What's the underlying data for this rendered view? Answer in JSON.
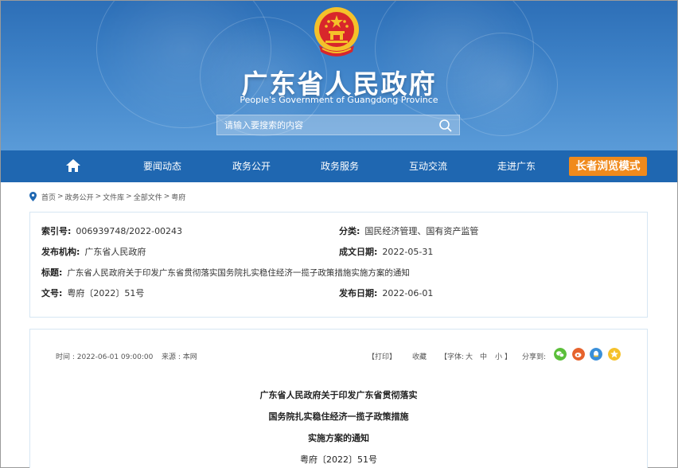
{
  "banner": {
    "title": "广东省人民政府",
    "subtitle": "People's Government of Guangdong Province",
    "search_placeholder": "请输入要搜索的内容"
  },
  "nav": {
    "items": [
      "要闻动态",
      "政务公开",
      "政务服务",
      "互动交流",
      "走进广东"
    ],
    "elder_mode": "长者浏览模式"
  },
  "breadcrumb": [
    "首页",
    "政务公开",
    "文件库",
    "全部文件",
    "粤府"
  ],
  "meta": {
    "index_no_label": "索引号:",
    "index_no": "006939748/2022-00243",
    "category_label": "分类:",
    "category": "国民经济管理、国有资产监管",
    "publisher_label": "发布机构:",
    "publisher": "广东省人民政府",
    "created_label": "成文日期:",
    "created": "2022-05-31",
    "title_label": "标题:",
    "title": "广东省人民政府关于印发广东省贯彻落实国务院扎实稳住经济一揽子政策措施实施方案的通知",
    "doc_no_label": "文号:",
    "doc_no": "粤府〔2022〕51号",
    "published_label": "发布日期:",
    "published": "2022-06-01"
  },
  "article": {
    "time": "时间 : 2022-06-01 09:00:00",
    "source": "来源 : 本网",
    "print": "【打印】",
    "favorite": "收藏",
    "font_label": "【字体:",
    "font_large": "大",
    "font_medium": "中",
    "font_small": "小",
    "font_close": "】",
    "share_label": "分享到:",
    "heading_lines": [
      "广东省人民政府关于印发广东省贯彻落实",
      "国务院扎实稳住经济一揽子政策措施",
      "实施方案的通知"
    ],
    "doc_no": "粤府〔2022〕51号"
  },
  "colors": {
    "nav": "#1f67b1",
    "banner": "#3f83c8",
    "elder": "#f08a1c",
    "wechat": "#5bbf3a",
    "weibo": "#e6632d",
    "qq": "#3a8fd9",
    "qzone": "#f5c12a"
  }
}
